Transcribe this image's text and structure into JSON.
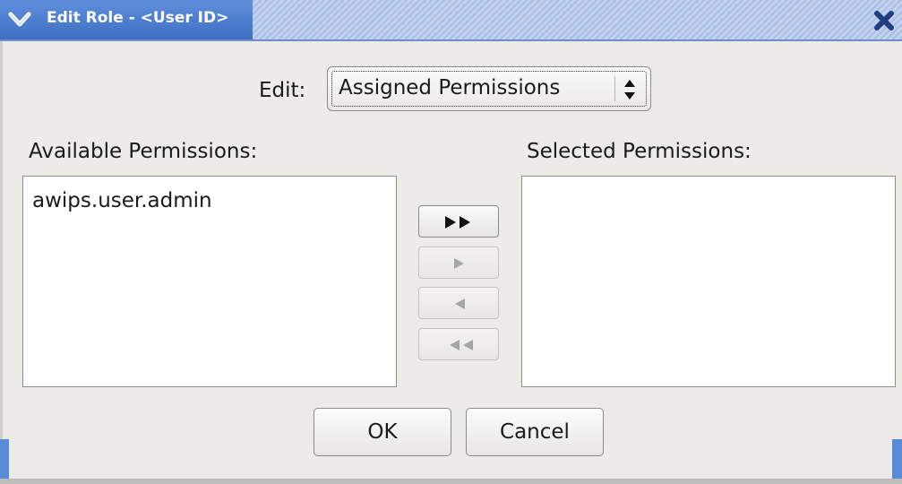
{
  "window": {
    "title": "Edit Role - <User ID>"
  },
  "edit": {
    "label": "Edit:",
    "selected": "Assigned Permissions"
  },
  "available": {
    "label": "Available Permissions:",
    "items": [
      "awips.user.admin"
    ]
  },
  "selected": {
    "label": "Selected Permissions:",
    "items": []
  },
  "transfer": {
    "add_all_icon": "double-arrow-right-icon",
    "add_icon": "arrow-right-icon",
    "remove_icon": "arrow-left-icon",
    "remove_all_icon": "double-arrow-left-icon",
    "add_all_enabled": true,
    "add_enabled": false,
    "remove_enabled": false,
    "remove_all_enabled": false
  },
  "buttons": {
    "ok": "OK",
    "cancel": "Cancel"
  },
  "colors": {
    "titlebar": "#3e6fc3",
    "window_bg": "#ecebe7"
  }
}
